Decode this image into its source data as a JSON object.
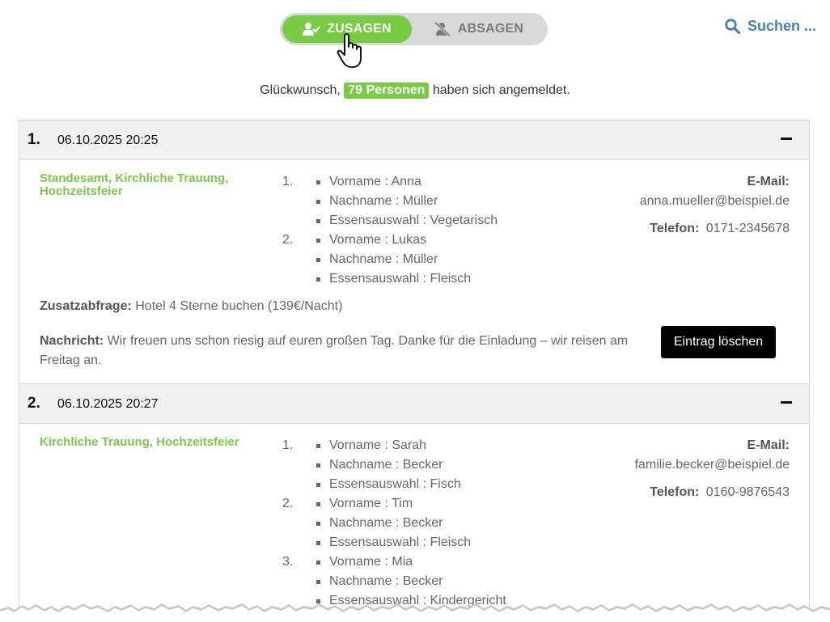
{
  "toggle": {
    "accepted_label": "ZUSAGEN",
    "declined_label": "ABSAGEN"
  },
  "search": {
    "label": "Suchen ..."
  },
  "summary": {
    "prefix": "Glückwunsch,",
    "count_label": "79 Personen",
    "suffix": "haben sich angemeldet."
  },
  "entries": [
    {
      "number": "1.",
      "datetime": "06.10.2025 20:25",
      "events": "Standesamt, Kirchliche Trauung, Hochzeitsfeier",
      "guests": [
        {
          "num": "1.",
          "lines": [
            "Vorname : Anna",
            "Nachname : Müller",
            "Essensauswahl : Vegetarisch"
          ]
        },
        {
          "num": "2.",
          "lines": [
            "Vorname : Lukas",
            "Nachname : Müller",
            "Essensauswahl : Fleisch"
          ]
        }
      ],
      "email_label": "E-Mail:",
      "email": "anna.mueller@beispiel.de",
      "phone_label": "Telefon:",
      "phone": "0171-2345678",
      "extra_label": "Zusatzabfrage:",
      "extra": "Hotel 4 Sterne buchen (139€/Nacht)",
      "message_label": "Nachricht:",
      "message": "Wir freuen uns schon riesig auf euren großen Tag. Danke für die Einladung – wir reisen am Freitag an.",
      "delete_label": "Eintrag löschen"
    },
    {
      "number": "2.",
      "datetime": "06.10.2025 20:27",
      "events": "Kirchliche Trauung, Hochzeitsfeier",
      "guests": [
        {
          "num": "1.",
          "lines": [
            "Vorname : Sarah",
            "Nachname : Becker",
            "Essensauswahl : Fisch"
          ]
        },
        {
          "num": "2.",
          "lines": [
            "Vorname : Tim",
            "Nachname : Becker",
            "Essensauswahl : Fleisch"
          ]
        },
        {
          "num": "3.",
          "lines": [
            "Vorname : Mia",
            "Nachname : Becker",
            "Essensauswahl : Kindergericht"
          ]
        }
      ],
      "email_label": "E-Mail:",
      "email": "familie.becker@beispiel.de",
      "phone_label": "Telefon:",
      "phone": "0160-9876543"
    }
  ],
  "colors": {
    "accent_green": "#77cc44",
    "link_blue": "#4a7fc4"
  },
  "icons": [
    "user-check-icon",
    "user-cancel-icon",
    "search-icon",
    "hand-cursor-icon",
    "collapse-minus-icon"
  ]
}
